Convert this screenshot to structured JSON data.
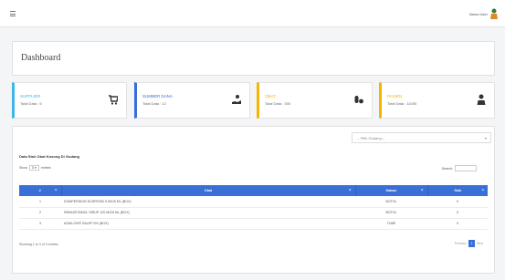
{
  "topbar": {
    "user_name": "Nama User"
  },
  "header": {
    "title": "Dashboard"
  },
  "stats": [
    {
      "name": "SUPPLIER",
      "total": "Total Data : 5",
      "color": "#3fb6e8",
      "icon": "cart-icon"
    },
    {
      "name": "SUMBER DANA",
      "total": "Total Data : 12",
      "color": "#3a6fd8",
      "icon": "money-hand-icon"
    },
    {
      "name": "OBAT",
      "total": "Total Data : 300",
      "color": "#f5b400",
      "icon": "pills-icon"
    },
    {
      "name": "PASIEN",
      "total": "Total Data : 11000",
      "color": "#f5b400",
      "icon": "user-icon"
    }
  ],
  "panel": {
    "select_placeholder": "-- Pilih Gudang --",
    "section_title": "Data Stok Obat Kosong Di Gudang",
    "show_label": "Show",
    "show_value": "5",
    "entries_label": "entries",
    "search_label": "Search:",
    "columns": [
      "#",
      "Obat",
      "Satuan",
      "Stok"
    ],
    "rows": [
      {
        "no": "1",
        "obat": "DOMPERIDON SUSPENSI 5 MG/5 ML (BOX)",
        "satuan": "BOTOL",
        "stok": "0"
      },
      {
        "no": "2",
        "obat": "PARASETAMOL SIRUP 120 MG/5 ML (BOX)",
        "satuan": "BOTOL",
        "stok": "0"
      },
      {
        "no": "3",
        "obat": "ASIKLOVIR SALEP 5% (BOX)",
        "satuan": "TUBE",
        "stok": "0"
      }
    ],
    "info": "Showing 1 to 3 of 3 entries",
    "pager": {
      "prev": "Previous",
      "page": "1",
      "next": "Next"
    }
  }
}
